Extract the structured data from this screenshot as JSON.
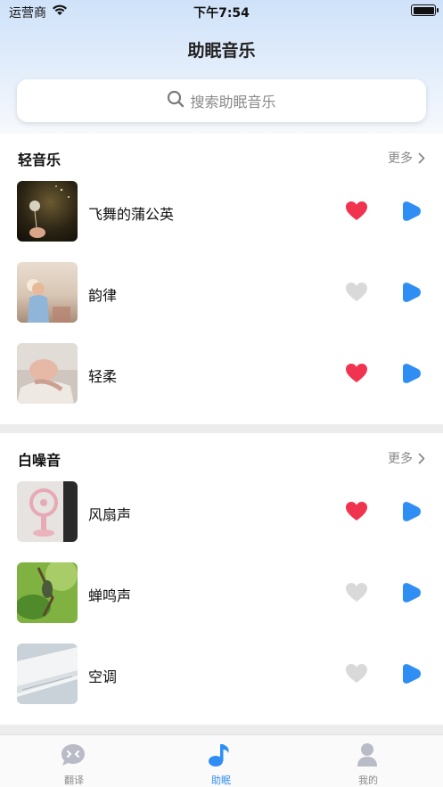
{
  "status_bar": {
    "carrier": "运营商",
    "time": "下午7:54"
  },
  "header": {
    "title": "助眠音乐"
  },
  "search": {
    "placeholder": "搜索助眠音乐"
  },
  "sections": [
    {
      "title": "轻音乐",
      "more": "更多",
      "items": [
        {
          "label": "飞舞的蒲公英",
          "favorited": true
        },
        {
          "label": "韵律",
          "favorited": false
        },
        {
          "label": "轻柔",
          "favorited": true
        }
      ]
    },
    {
      "title": "白噪音",
      "more": "更多",
      "items": [
        {
          "label": "风扇声",
          "favorited": true
        },
        {
          "label": "蝉鸣声",
          "favorited": false
        },
        {
          "label": "空调",
          "favorited": false
        }
      ]
    }
  ],
  "tabs": [
    {
      "label": "翻译",
      "icon": "translate-chat-icon",
      "active": false
    },
    {
      "label": "助眠",
      "icon": "music-note-icon",
      "active": true
    },
    {
      "label": "我的",
      "icon": "profile-person-icon",
      "active": false
    }
  ],
  "colors": {
    "accent": "#2f8ef4",
    "heart_on": "#f0334f",
    "heart_off": "#d9d9d9",
    "play": "#2f8ef4"
  }
}
